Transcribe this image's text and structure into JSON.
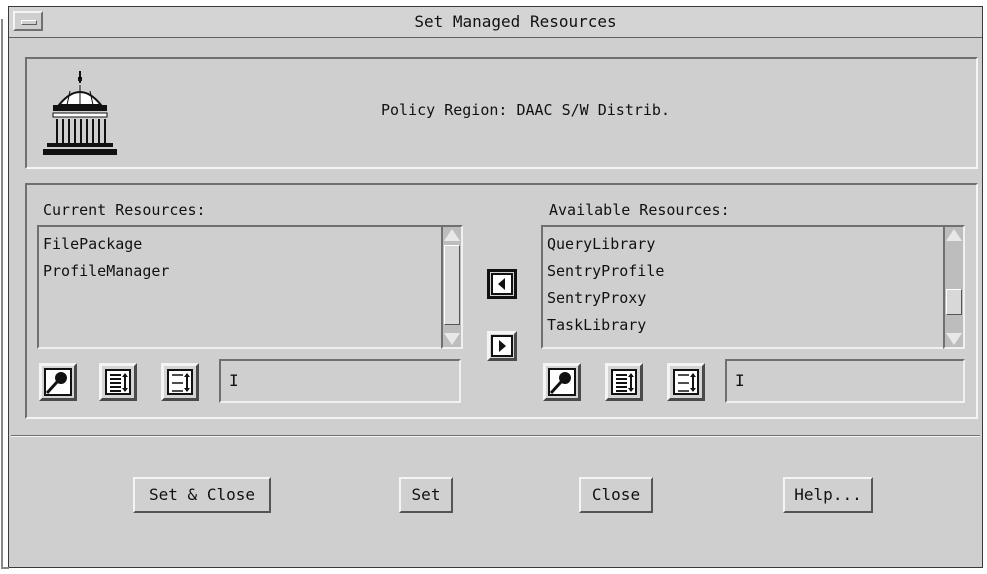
{
  "window": {
    "title": "Set Managed Resources"
  },
  "header": {
    "policy_region": "Policy Region: DAAC S/W Distrib."
  },
  "current": {
    "label": "Current Resources:",
    "items": [
      "FilePackage",
      "ProfileManager"
    ],
    "filter_value": ""
  },
  "available": {
    "label": "Available Resources:",
    "items": [
      "QueryLibrary",
      "SentryProfile",
      "SentryProxy",
      "TaskLibrary"
    ],
    "filter_value": ""
  },
  "buttons": {
    "set_close": "Set & Close",
    "set": "Set",
    "close": "Close",
    "help": "Help..."
  },
  "icons": {
    "header": "capitol-building-icon",
    "find": "magnifier-icon",
    "select_all": "select-all-list-icon",
    "deselect_all": "deselect-all-list-icon",
    "move_left": "arrow-left-icon",
    "move_right": "arrow-right-icon"
  }
}
